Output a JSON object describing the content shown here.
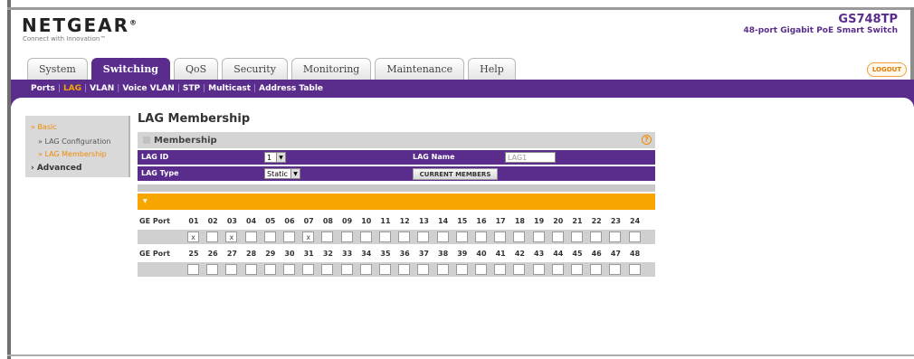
{
  "header": {
    "brand": "NETGEAR",
    "brand_mark": "®",
    "tagline": "Connect with Innovation™",
    "model": "GS748TP",
    "model_desc": "48-port Gigabit PoE Smart Switch",
    "logout_label": "LOGOUT"
  },
  "tabs": [
    {
      "label": "System"
    },
    {
      "label": "Switching"
    },
    {
      "label": "QoS"
    },
    {
      "label": "Security"
    },
    {
      "label": "Monitoring"
    },
    {
      "label": "Maintenance"
    },
    {
      "label": "Help"
    }
  ],
  "subnav": [
    {
      "label": "Ports"
    },
    {
      "label": "LAG"
    },
    {
      "label": "VLAN"
    },
    {
      "label": "Voice VLAN"
    },
    {
      "label": "STP"
    },
    {
      "label": "Multicast"
    },
    {
      "label": "Address Table"
    }
  ],
  "sidebar": {
    "basic": "» Basic",
    "item1": "» LAG Configuration",
    "item2": "» LAG Membership",
    "advanced": "› Advanced"
  },
  "main": {
    "title": "LAG Membership",
    "section": "Membership",
    "help": "?",
    "lag_id_label": "LAG ID",
    "lag_id_value": "1",
    "lag_name_label": "LAG Name",
    "lag_name_value": "LAG1",
    "lag_type_label": "LAG Type",
    "lag_type_value": "Static",
    "current_members": "CURRENT MEMBERS",
    "ge_port_label": "GE Port",
    "ports_row1": [
      "01",
      "02",
      "03",
      "04",
      "05",
      "06",
      "07",
      "08",
      "09",
      "10",
      "11",
      "12",
      "13",
      "14",
      "15",
      "16",
      "17",
      "18",
      "19",
      "20",
      "21",
      "22",
      "23",
      "24"
    ],
    "ports_row2": [
      "25",
      "26",
      "27",
      "28",
      "29",
      "30",
      "31",
      "32",
      "33",
      "34",
      "35",
      "36",
      "37",
      "38",
      "39",
      "40",
      "41",
      "42",
      "43",
      "44",
      "45",
      "46",
      "47",
      "48"
    ],
    "checked_row1": [
      "x",
      "",
      "x",
      "",
      "",
      "",
      "x",
      "",
      "",
      "",
      "",
      "",
      "",
      "",
      "",
      "",
      "",
      "",
      "",
      "",
      "",
      "",
      "",
      ""
    ],
    "checked_row2": [
      "",
      "",
      "",
      "",
      "",
      "",
      "",
      "",
      "",
      "",
      "",
      "",
      "",
      "",
      "",
      "",
      "",
      "",
      "",
      "",
      "",
      "",
      "",
      ""
    ]
  }
}
